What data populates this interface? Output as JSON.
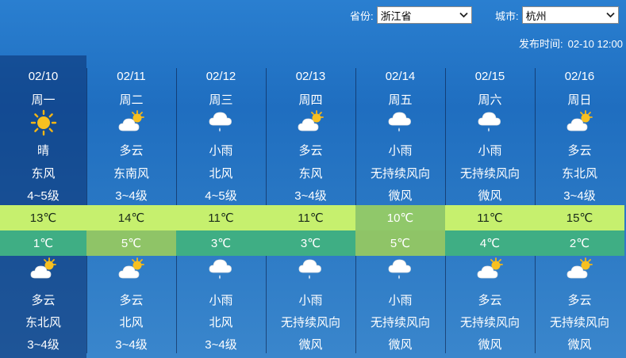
{
  "controls": {
    "province_label": "省份:",
    "province_value": "浙江省",
    "city_label": "城市:",
    "city_value": "杭州",
    "publish_label": "发布时间:",
    "publish_value": "02-10 12:00"
  },
  "days": [
    {
      "date": "02/10",
      "week": "周一",
      "day_icon": "sun-icon",
      "day_cond": "晴",
      "day_wind": "东风",
      "day_level": "4~5级",
      "high": "13℃",
      "low": "1℃",
      "night_icon": "cloudy-icon",
      "night_cond": "多云",
      "night_wind": "东北风",
      "night_level": "3~4级"
    },
    {
      "date": "02/11",
      "week": "周二",
      "day_icon": "cloudy-icon",
      "day_cond": "多云",
      "day_wind": "东南风",
      "day_level": "3~4级",
      "high": "14℃",
      "low": "5℃",
      "night_icon": "cloudy-icon",
      "night_cond": "多云",
      "night_wind": "北风",
      "night_level": "3~4级"
    },
    {
      "date": "02/12",
      "week": "周三",
      "day_icon": "rain-icon",
      "day_cond": "小雨",
      "day_wind": "北风",
      "day_level": "4~5级",
      "high": "11℃",
      "low": "3℃",
      "night_icon": "rain-icon",
      "night_cond": "小雨",
      "night_wind": "北风",
      "night_level": "3~4级"
    },
    {
      "date": "02/13",
      "week": "周四",
      "day_icon": "cloudy-icon",
      "day_cond": "多云",
      "day_wind": "东风",
      "day_level": "3~4级",
      "high": "11℃",
      "low": "3℃",
      "night_icon": "rain-icon",
      "night_cond": "小雨",
      "night_wind": "无持续风向",
      "night_level": "微风"
    },
    {
      "date": "02/14",
      "week": "周五",
      "day_icon": "rain-icon",
      "day_cond": "小雨",
      "day_wind": "无持续风向",
      "day_level": "微风",
      "high": "10℃",
      "low": "5℃",
      "night_icon": "rain-icon",
      "night_cond": "小雨",
      "night_wind": "无持续风向",
      "night_level": "微风"
    },
    {
      "date": "02/15",
      "week": "周六",
      "day_icon": "rain-icon",
      "day_cond": "小雨",
      "day_wind": "无持续风向",
      "day_level": "微风",
      "high": "11℃",
      "low": "4℃",
      "night_icon": "cloudy-icon",
      "night_cond": "多云",
      "night_wind": "无持续风向",
      "night_level": "微风"
    },
    {
      "date": "02/16",
      "week": "周日",
      "day_icon": "cloudy-icon",
      "day_cond": "多云",
      "day_wind": "东北风",
      "day_level": "3~4级",
      "high": "15℃",
      "low": "2℃",
      "night_icon": "cloudy-icon",
      "night_cond": "多云",
      "night_wind": "无持续风向",
      "night_level": "微风"
    }
  ],
  "colors": {
    "high_band": "#c6f06e",
    "low_band": "#3fae84",
    "highlight_band": "#90c86a"
  }
}
